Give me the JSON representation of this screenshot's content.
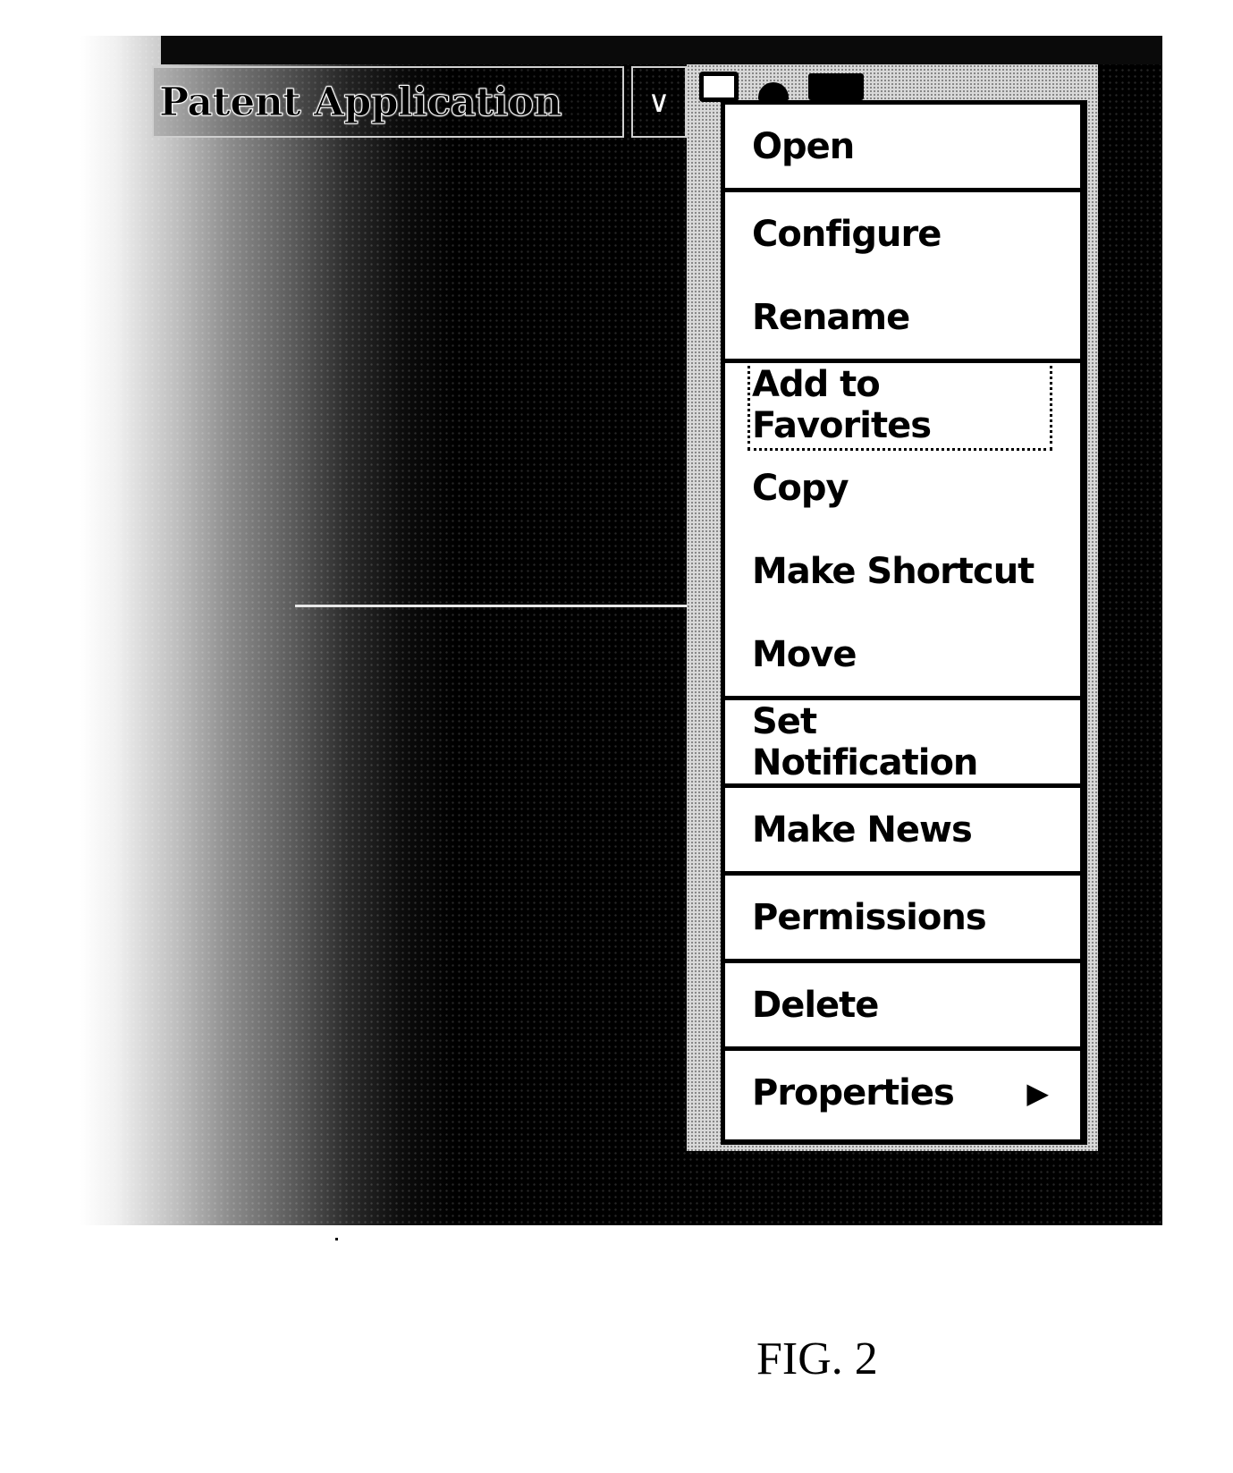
{
  "title_field": {
    "value": "Patent Application"
  },
  "dropdown": {
    "icon": "chevron-down-icon",
    "glyph": "∨"
  },
  "toolbar": {
    "icons": [
      "window-icon",
      "hill-icon",
      "folder-icon"
    ]
  },
  "context_menu": {
    "groups": [
      {
        "items": [
          {
            "label": "Open"
          }
        ]
      },
      {
        "items": [
          {
            "label": "Configure"
          },
          {
            "label": "Rename"
          }
        ]
      },
      {
        "items": [
          {
            "label": "Add to Favorites",
            "focused": true
          },
          {
            "label": "Copy"
          },
          {
            "label": "Make Shortcut"
          },
          {
            "label": "Move"
          }
        ]
      },
      {
        "items": [
          {
            "label": "Set Notification"
          }
        ]
      },
      {
        "items": [
          {
            "label": "Make News"
          }
        ]
      },
      {
        "items": [
          {
            "label": "Permissions"
          }
        ]
      },
      {
        "items": [
          {
            "label": "Delete"
          }
        ]
      },
      {
        "items": [
          {
            "label": "Properties",
            "submenu": true,
            "arrow": "▶"
          }
        ]
      }
    ]
  },
  "figure": {
    "caption": "FIG. 2"
  }
}
